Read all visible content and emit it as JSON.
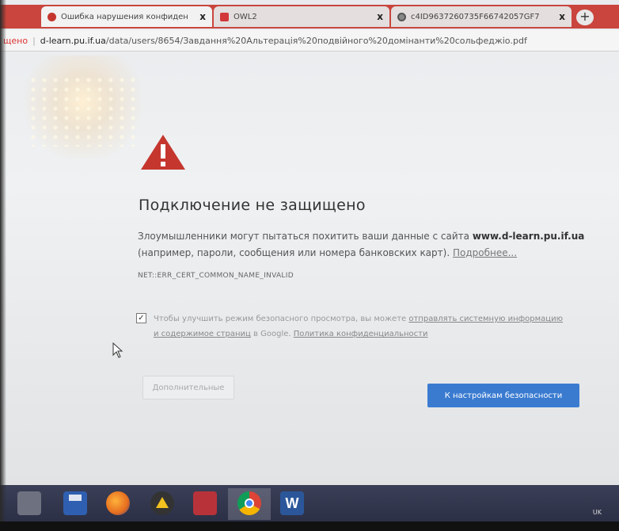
{
  "tabs": [
    {
      "title": "Ошибка нарушения конфиден",
      "close": "x",
      "favicon": "chrome-error-icon",
      "active": true
    },
    {
      "title": "OWL2",
      "close": "x",
      "favicon": "owl-icon",
      "active": false
    },
    {
      "title": "c4ID9637260735F66742057GF7",
      "close": "x",
      "favicon": "globe-icon",
      "active": false
    }
  ],
  "new_tab": "+",
  "address": {
    "security_label": "щено",
    "separator": "|",
    "host": "d-learn.pu.if.ua",
    "path": "/data/users/8654/Завдання%20Альтерація%20подвійного%20домінанти%20сольфеджіо.pdf"
  },
  "interstitial": {
    "heading": "Подключение не защищено",
    "explanation_pre": "Злоумышленники могут пытаться похитить ваши данные с сайта",
    "explanation_host": "www.d-learn.pu.if.ua",
    "explanation_post": "(например, пароли, сообщения или номера банковских карт).",
    "more_link": "Подробнее...",
    "error_code": "NET::ERR_CERT_COMMON_NAME_INVALID",
    "checkbox_checked": true,
    "checkbox_text_pre": "Чтобы улучшить режим безопасного просмотра, вы можете",
    "checkbox_link_1": "отправлять системную информацию и содержимое страниц",
    "checkbox_text_mid": "в Google.",
    "checkbox_link_2": "Политика конфиденциальности",
    "details_button": "Дополнительные",
    "back_button": "К настройкам безопасности"
  },
  "taskbar": {
    "items": [
      "explorer-icon",
      "save-icon",
      "firefox-icon",
      "drive-icon",
      "app-icon",
      "chrome-icon",
      "word-icon"
    ],
    "lang": "UK"
  },
  "colors": {
    "tabstrip": "#c9453d",
    "warning": "#c5362e",
    "primary_button": "#3a7bd0",
    "taskbar": "#2b2f45"
  }
}
